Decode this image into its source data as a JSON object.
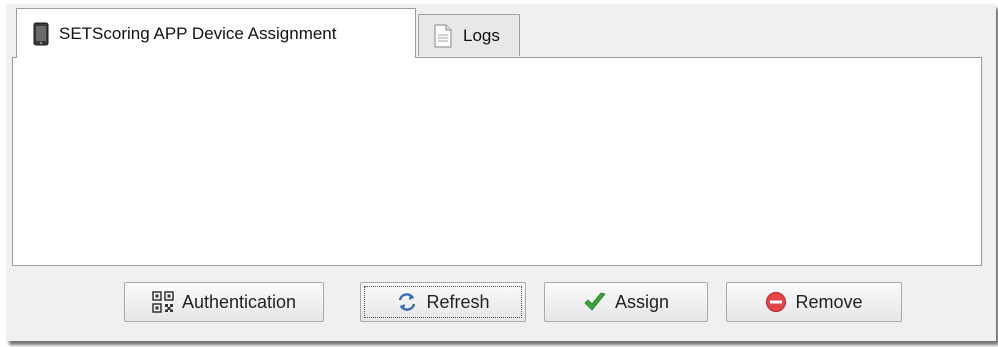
{
  "tabs": [
    {
      "label": "SETScoring APP Device Assignment",
      "icon": "phone-icon",
      "active": true
    },
    {
      "label": "Logs",
      "icon": "document-icon",
      "active": false
    }
  ],
  "buttons": {
    "authentication": {
      "label": "Authentication",
      "icon": "qr-code-icon"
    },
    "refresh": {
      "label": "Refresh",
      "icon": "refresh-icon",
      "focused": true
    },
    "assign": {
      "label": "Assign",
      "icon": "checkmark-icon",
      "color": "#3aa53a"
    },
    "remove": {
      "label": "Remove",
      "icon": "remove-icon",
      "color": "#e2454a"
    }
  }
}
